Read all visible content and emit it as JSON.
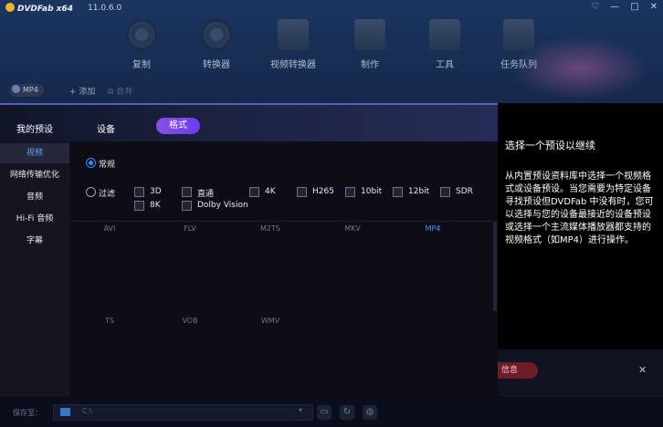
{
  "app": {
    "name": "DVDFab x64",
    "version": "11.0.6.0"
  },
  "window_controls": [
    "♡",
    "—",
    "□",
    "✕"
  ],
  "topnav": [
    {
      "label": "复制",
      "icon": "disc-copy-icon"
    },
    {
      "label": "转换器",
      "icon": "disc-convert-icon"
    },
    {
      "label": "视频转换器",
      "icon": "film-convert-icon"
    },
    {
      "label": "制作",
      "icon": "film-create-icon"
    },
    {
      "label": "工具",
      "icon": "toolbox-icon"
    },
    {
      "label": "任务队列",
      "icon": "queue-icon"
    }
  ],
  "subbar": {
    "profile": "MP4",
    "add_label": "添加",
    "merge_label": "合并"
  },
  "dialog": {
    "tabs": {
      "my_presets": "我的预设",
      "device": "设备",
      "format": "格式"
    },
    "sidebar": [
      "视频",
      "网络传输优化",
      "音频",
      "Hi-Fi 音频",
      "字幕"
    ],
    "common_label": "常规",
    "filter_label": "过滤",
    "filters": [
      "3D",
      "直通",
      "4K",
      "H265",
      "10bit",
      "12bit",
      "SDR",
      "8K",
      "Dolby Vision"
    ],
    "formats": [
      "AVI",
      "FLV",
      "M2TS",
      "MKV",
      "MP4",
      "TS",
      "VOB",
      "WMV"
    ],
    "selected_format": "MP4"
  },
  "right_panel": {
    "title": "选择一个预设以继续",
    "body": "从内置预设资料库中选择一个视频格式或设备预设。当您需要为特定设备寻找预设但DVDFab 中没有时，您可以选择与您的设备最接近的设备预设或选择一个主流媒体播放器都支持的视频格式（如MP4）进行操作。",
    "button": "信息",
    "close": "✕"
  },
  "bottombar": {
    "save_label": "保存至：",
    "path": "C:\\",
    "dropdown": "▾",
    "icons": [
      "folder-open-icon",
      "refresh-icon",
      "globe-icon"
    ]
  }
}
